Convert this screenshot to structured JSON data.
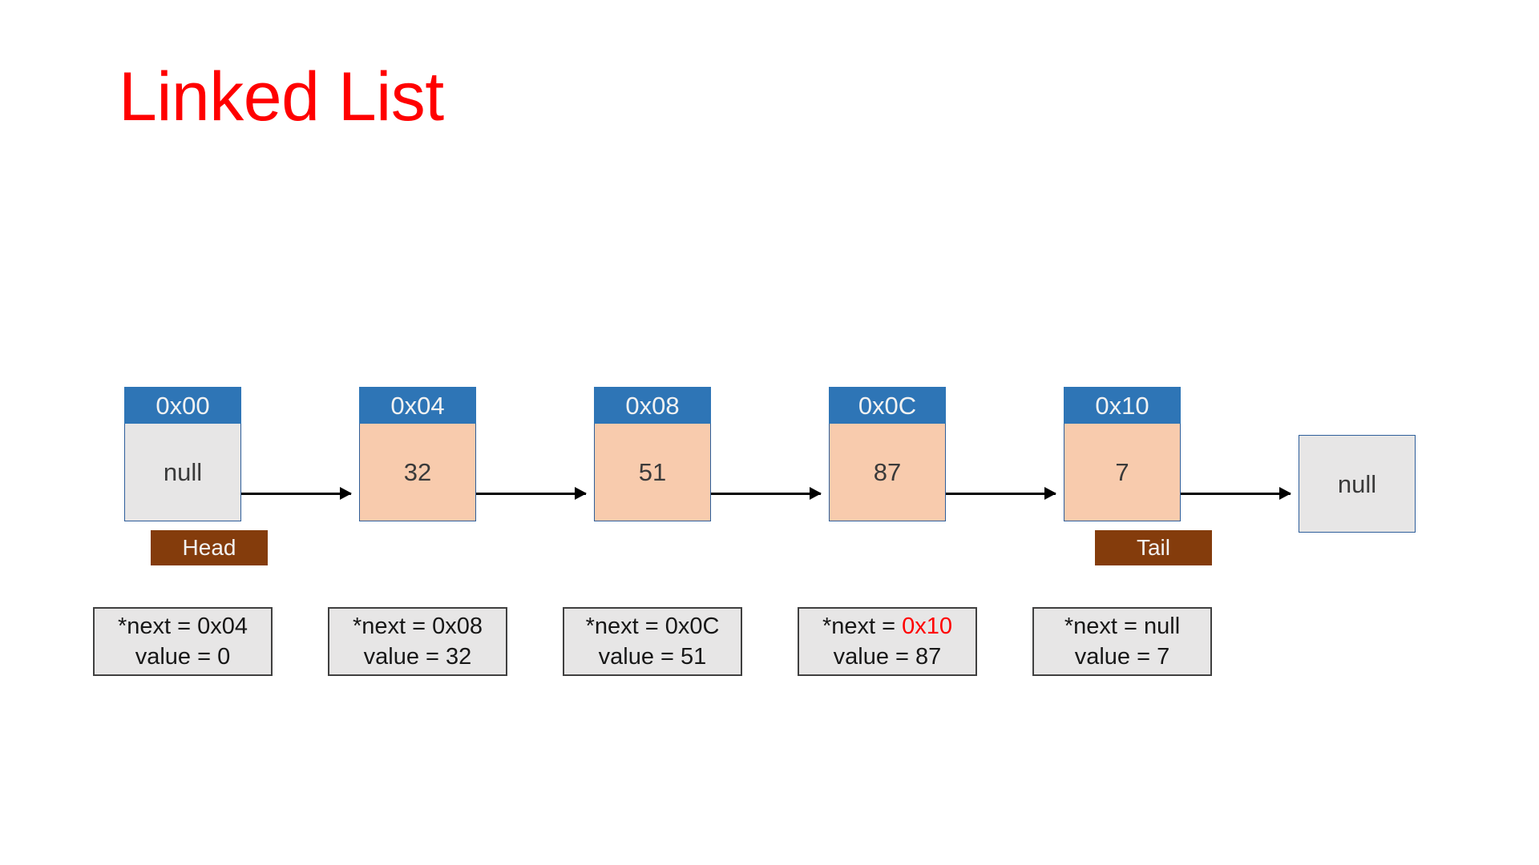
{
  "slide": {
    "title": "Linked List",
    "title_color": "#FF0000",
    "background_color": "#FFFFFF"
  },
  "palette": {
    "header_blue": "#2E75B6",
    "body_peach": "#F8CBAD",
    "body_gray": "#E7E6E6",
    "badge_brown": "#843C0C",
    "border_blue": "#2E5E9A",
    "caption_border": "#404040",
    "arrow_black": "#000000",
    "accent_red": "#FF0000"
  },
  "diagram": {
    "type": "linked-list",
    "nodes": [
      {
        "address": "0x00",
        "value": "null",
        "fill": "gray",
        "marker": "Head"
      },
      {
        "address": "0x04",
        "value": "32",
        "fill": "peach",
        "marker": null
      },
      {
        "address": "0x08",
        "value": "51",
        "fill": "peach",
        "marker": null
      },
      {
        "address": "0x0C",
        "value": "87",
        "fill": "peach",
        "marker": null
      },
      {
        "address": "0x10",
        "value": "7",
        "fill": "peach",
        "marker": "Tail"
      }
    ],
    "terminal": {
      "value": "null"
    },
    "captions": [
      {
        "next_label": "*next = ",
        "next_value": "0x04",
        "next_highlight": false,
        "value_line": "value = 0"
      },
      {
        "next_label": "*next = ",
        "next_value": "0x08",
        "next_highlight": false,
        "value_line": "value = 32"
      },
      {
        "next_label": "*next = ",
        "next_value": "0x0C",
        "next_highlight": false,
        "value_line": "value = 51"
      },
      {
        "next_label": "*next = ",
        "next_value": "0x10",
        "next_highlight": true,
        "value_line": "value = 87"
      },
      {
        "next_label": "*next = ",
        "next_value": "null",
        "next_highlight": false,
        "value_line": "value = 7"
      }
    ],
    "arrow_count": 5
  }
}
